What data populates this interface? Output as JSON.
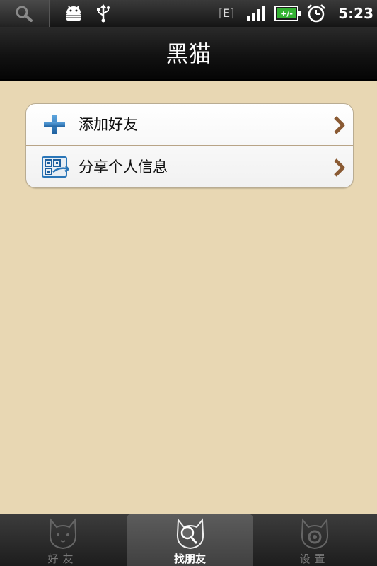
{
  "status_bar": {
    "network_type": "E",
    "time": "5:23",
    "battery_label": "+/-",
    "icons": [
      "search-icon",
      "android-debug-icon",
      "usb-icon",
      "edge-network-icon",
      "signal-icon",
      "battery-charging-icon",
      "alarm-icon"
    ]
  },
  "header": {
    "title": "黑猫"
  },
  "menu": {
    "items": [
      {
        "label": "添加好友",
        "icon": "plus-icon"
      },
      {
        "label": "分享个人信息",
        "icon": "qr-share-icon"
      }
    ]
  },
  "tabs": [
    {
      "label": "好友",
      "icon": "cat-friends-icon",
      "selected": false
    },
    {
      "label": "找朋友",
      "icon": "cat-search-icon",
      "selected": true
    },
    {
      "label": "设置",
      "icon": "cat-settings-icon",
      "selected": false
    }
  ],
  "colors": {
    "background": "#e8d7b3",
    "title_bar": "#121212",
    "accent_blue": "#2a76b8",
    "chevron": "#8a5a33"
  }
}
